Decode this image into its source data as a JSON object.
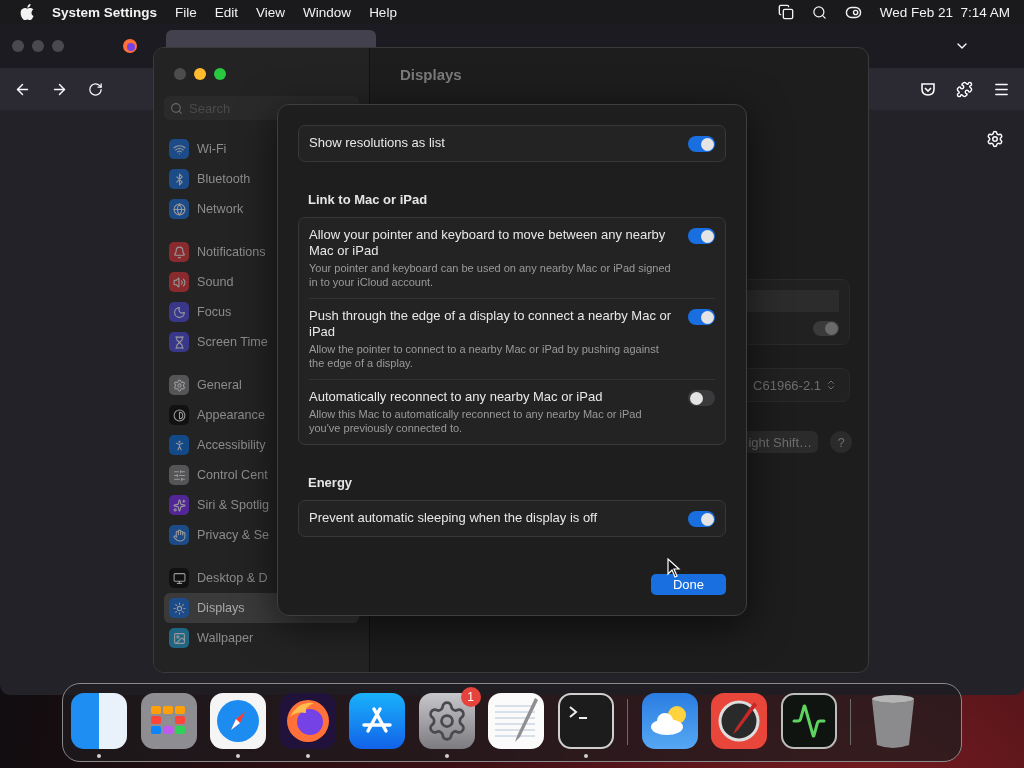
{
  "menu_bar": {
    "app_name": "System Settings",
    "menus": [
      "File",
      "Edit",
      "View",
      "Window",
      "Help"
    ],
    "clock": "Wed Feb 21  7:14 AM"
  },
  "browser": {
    "tabs": [
      {
        "selected": true
      }
    ]
  },
  "settings": {
    "title": "Displays",
    "search": {
      "placeholder": "Search"
    },
    "sidebar": [
      [
        {
          "label": "Wi-Fi",
          "kind": "wifi",
          "selected": false
        },
        {
          "label": "Bluetooth",
          "kind": "bluetooth",
          "selected": false
        },
        {
          "label": "Network",
          "kind": "network",
          "selected": false
        }
      ],
      [
        {
          "label": "Notifications",
          "kind": "notifications",
          "selected": false
        },
        {
          "label": "Sound",
          "kind": "sound",
          "selected": false
        },
        {
          "label": "Focus",
          "kind": "focus",
          "selected": false
        },
        {
          "label": "Screen Time",
          "kind": "screentime",
          "selected": false
        }
      ],
      [
        {
          "label": "General",
          "kind": "general",
          "selected": false
        },
        {
          "label": "Appearance",
          "kind": "appearance",
          "selected": false
        },
        {
          "label": "Accessibility",
          "kind": "accessibility",
          "selected": false
        },
        {
          "label": "Control Cent",
          "kind": "control",
          "selected": false
        },
        {
          "label": "Siri & Spotlig",
          "kind": "siri",
          "selected": false
        },
        {
          "label": "Privacy & Se",
          "kind": "privacy",
          "selected": false
        }
      ],
      [
        {
          "label": "Desktop & D",
          "kind": "desktop",
          "selected": false
        },
        {
          "label": "Displays",
          "kind": "displays",
          "selected": true
        },
        {
          "label": "Wallpaper",
          "kind": "wallpaper",
          "selected": false
        }
      ]
    ],
    "background": {
      "toggle_on": true,
      "color_profile": "C61966-2.1",
      "night_shift_button": "ight Shift…",
      "help_button": "?"
    }
  },
  "sheet": {
    "sections": [
      {
        "rows": [
          {
            "title": "Show resolutions as list",
            "on": true
          }
        ]
      },
      {
        "heading": "Link to Mac or iPad",
        "rows": [
          {
            "title": "Allow your pointer and keyboard to move between any nearby Mac or iPad",
            "description": "Your pointer and keyboard can be used on any nearby Mac or iPad signed in to your iCloud account.",
            "on": true
          },
          {
            "title": "Push through the edge of a display to connect a nearby Mac or iPad",
            "description": "Allow the pointer to connect to a nearby Mac or iPad by pushing against the edge of a display.",
            "on": true
          },
          {
            "title": "Automatically reconnect to any nearby Mac or iPad",
            "description": "Allow this Mac to automatically reconnect to any nearby Mac or iPad you've previously connected to.",
            "on": false
          }
        ]
      },
      {
        "heading": "Energy",
        "rows": [
          {
            "title": "Prevent automatic sleeping when the display is off",
            "on": true
          }
        ]
      }
    ],
    "done_button": "Done"
  },
  "dock": [
    {
      "kind": "finder",
      "running": true
    },
    {
      "kind": "launchpad",
      "running": false
    },
    {
      "kind": "safari",
      "running": true
    },
    {
      "kind": "firefox",
      "running": true
    },
    {
      "kind": "appstore",
      "running": false
    },
    {
      "kind": "settings",
      "running": true,
      "badge": "1"
    },
    {
      "kind": "textedit",
      "running": false
    },
    {
      "kind": "terminal",
      "running": true
    },
    {
      "kind": "separator"
    },
    {
      "kind": "weather",
      "running": false
    },
    {
      "kind": "colormeter",
      "running": false
    },
    {
      "kind": "activity",
      "running": false
    },
    {
      "kind": "separator"
    },
    {
      "kind": "trash",
      "running": false
    }
  ]
}
